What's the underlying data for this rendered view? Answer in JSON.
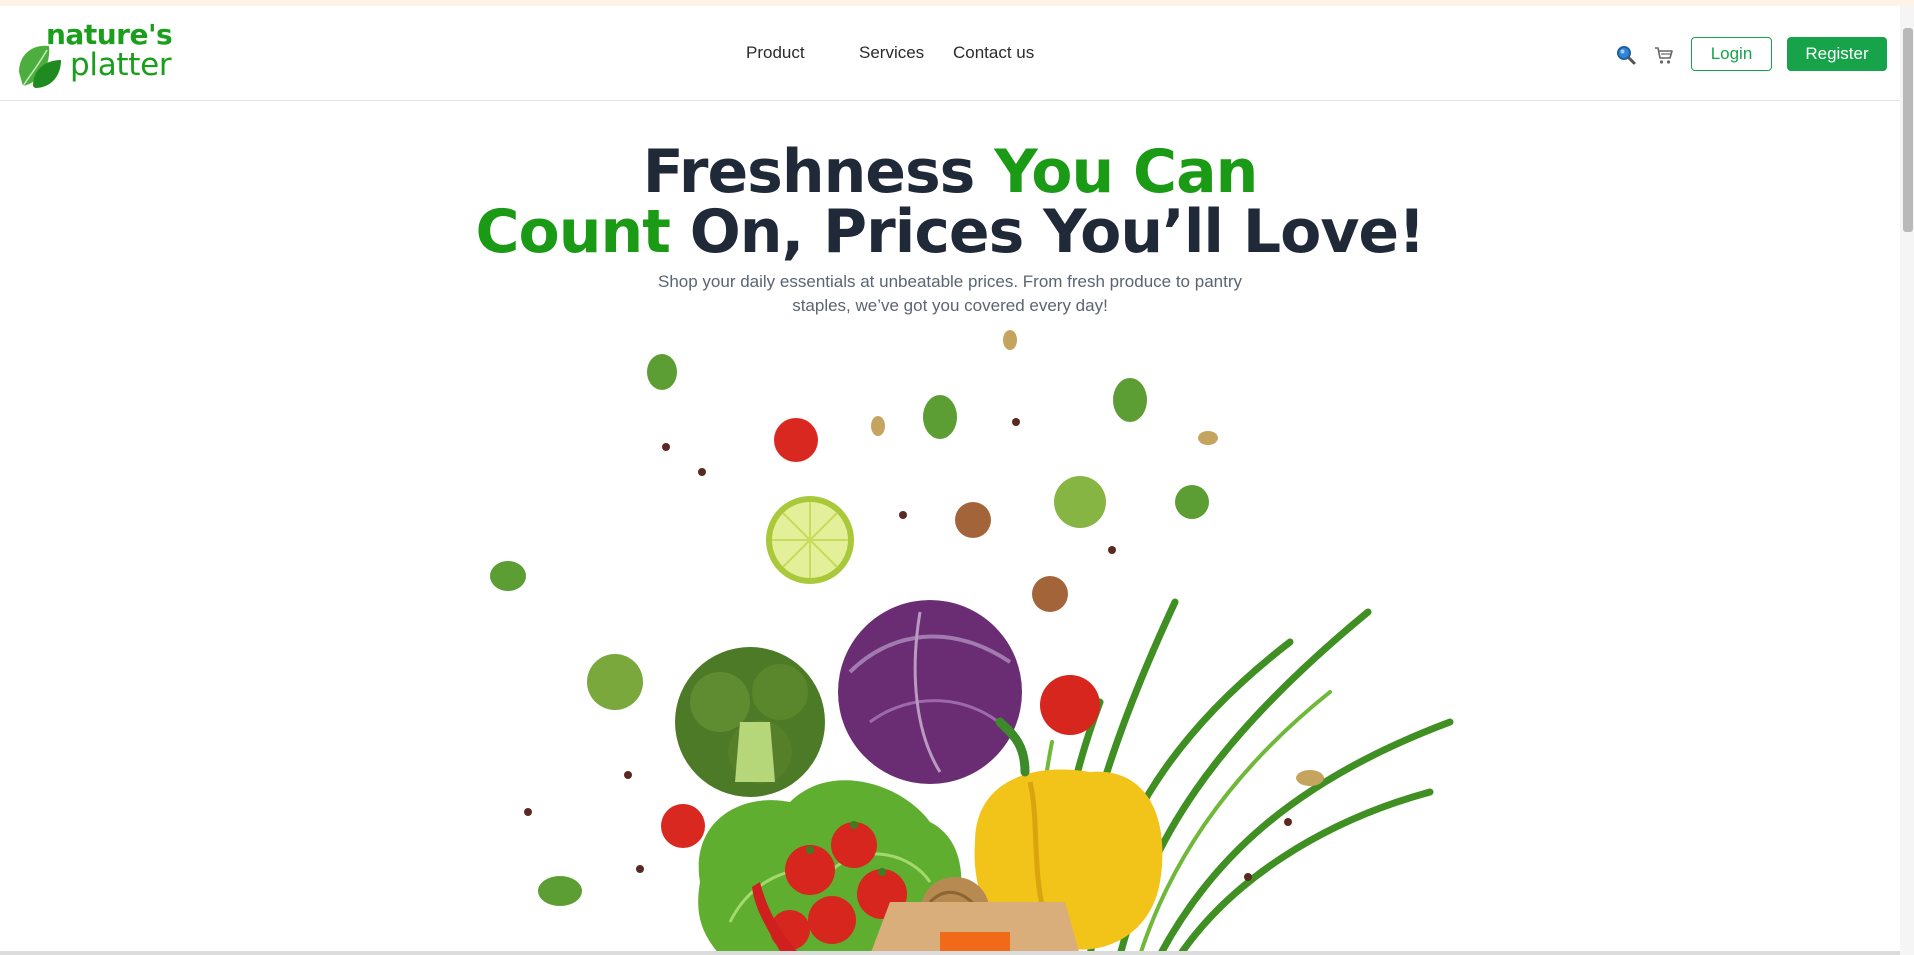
{
  "brand": {
    "line1": "nature's",
    "line2": "platter",
    "color": "#1b9e1b"
  },
  "nav": {
    "items": [
      {
        "label": "Product"
      },
      {
        "label": "Services"
      },
      {
        "label": "Contact us"
      }
    ]
  },
  "header_actions": {
    "search_icon": "search-icon",
    "cart_icon": "cart-icon",
    "login_label": "Login",
    "register_label": "Register",
    "accent": "#16a34a"
  },
  "hero": {
    "title_dark_1": "Freshness ",
    "title_green_1": "You Can",
    "title_green_2": "Count",
    "title_dark_2": " On, Prices You’ll Love!",
    "subtitle": "Shop your daily essentials at unbeatable prices. From fresh produce to pantry staples, we’ve got you covered every day!",
    "title_color": "#1f2937",
    "highlight_color": "#1a9a15"
  }
}
